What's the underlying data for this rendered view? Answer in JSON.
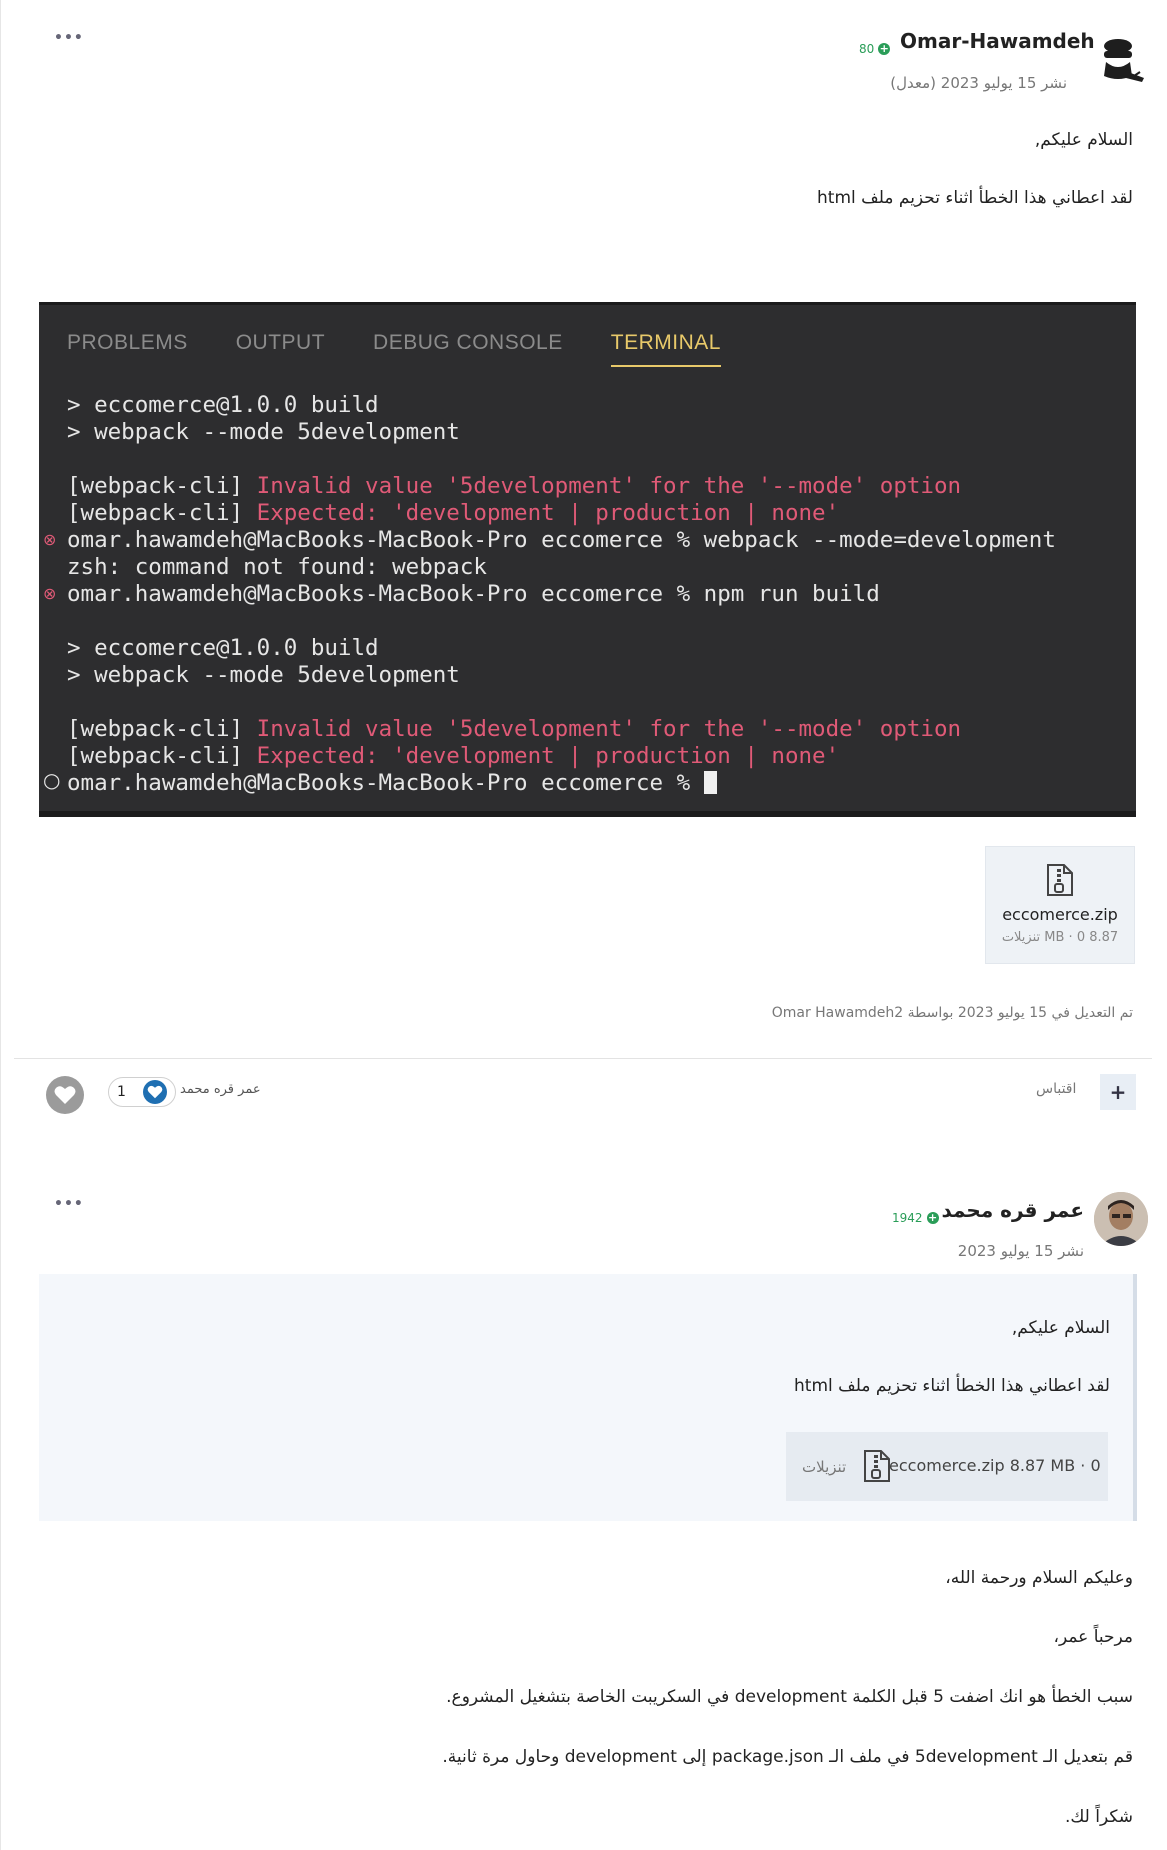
{
  "post1": {
    "more_label": "•••",
    "author": "Omar-Hawamdeh",
    "reputation": "80",
    "posted": "نشر 15 يوليو 2023 (معدل)",
    "greeting": "السلام عليكم,",
    "body": "لقد اعطاني هذا الخطأ اثناء تحزيم ملف html",
    "terminal": {
      "tabs": [
        "PROBLEMS",
        "OUTPUT",
        "DEBUG CONSOLE",
        "TERMINAL"
      ],
      "lines": [
        "> eccomerce@1.0.0 build",
        "> webpack --mode 5development",
        "[webpack-cli] ",
        "Invalid value '5development' for the '--mode' option",
        "[webpack-cli] ",
        "Expected: 'development | production | none'",
        "omar.hawamdeh@MacBooks-MacBook-Pro eccomerce % webpack --mode=development",
        "zsh: command not found: webpack",
        "omar.hawamdeh@MacBooks-MacBook-Pro eccomerce % npm run build",
        "> eccomerce@1.0.0 build",
        "> webpack --mode 5development",
        "[webpack-cli] ",
        "Invalid value '5development' for the '--mode' option",
        "[webpack-cli] ",
        "Expected: 'development | production | none'",
        "omar.hawamdeh@MacBooks-MacBook-Pro eccomerce % "
      ]
    },
    "attachment": {
      "filename": "eccomerce.zip",
      "size": "8.87 MB · 0 تنزيلات"
    },
    "edited": "تم التعديل في 15 يوليو 2023 بواسطة Omar Hawamdeh2"
  },
  "actions": {
    "quote_label": "اقتباس",
    "quote_icon": "+",
    "reaction_count": "1",
    "reactor_name": "عمر قره محمد"
  },
  "post2": {
    "more_label": "•••",
    "author": "عمر قره محمد",
    "reputation": "1942",
    "posted": "نشر 15 يوليو 2023",
    "quote": {
      "greeting": "السلام عليكم,",
      "body": "لقد اعطاني هذا الخطأ اثناء تحزيم ملف html",
      "attachment_name": "eccomerce.zip",
      "attachment_meta": "8.87 MB · 0",
      "attachment_label": "تنزيلات"
    },
    "reply": [
      "وعليكم السلام ورحمة الله،",
      "مرحباً عمر،",
      "سبب الخطأ هو انك اضفت 5 قبل الكلمة development في السكريبت الخاصة بتشغيل المشروع.",
      "قم بتعديل الـ 5development في ملف الـ package.json إلى development وحاول مرة ثانية.",
      "شكراً لك."
    ]
  },
  "colors": {
    "terminal_bg": "#2d2d2f",
    "terminal_error": "#e05a77",
    "terminal_active_tab": "#e8c96a",
    "reputation": "#2a9d58"
  }
}
